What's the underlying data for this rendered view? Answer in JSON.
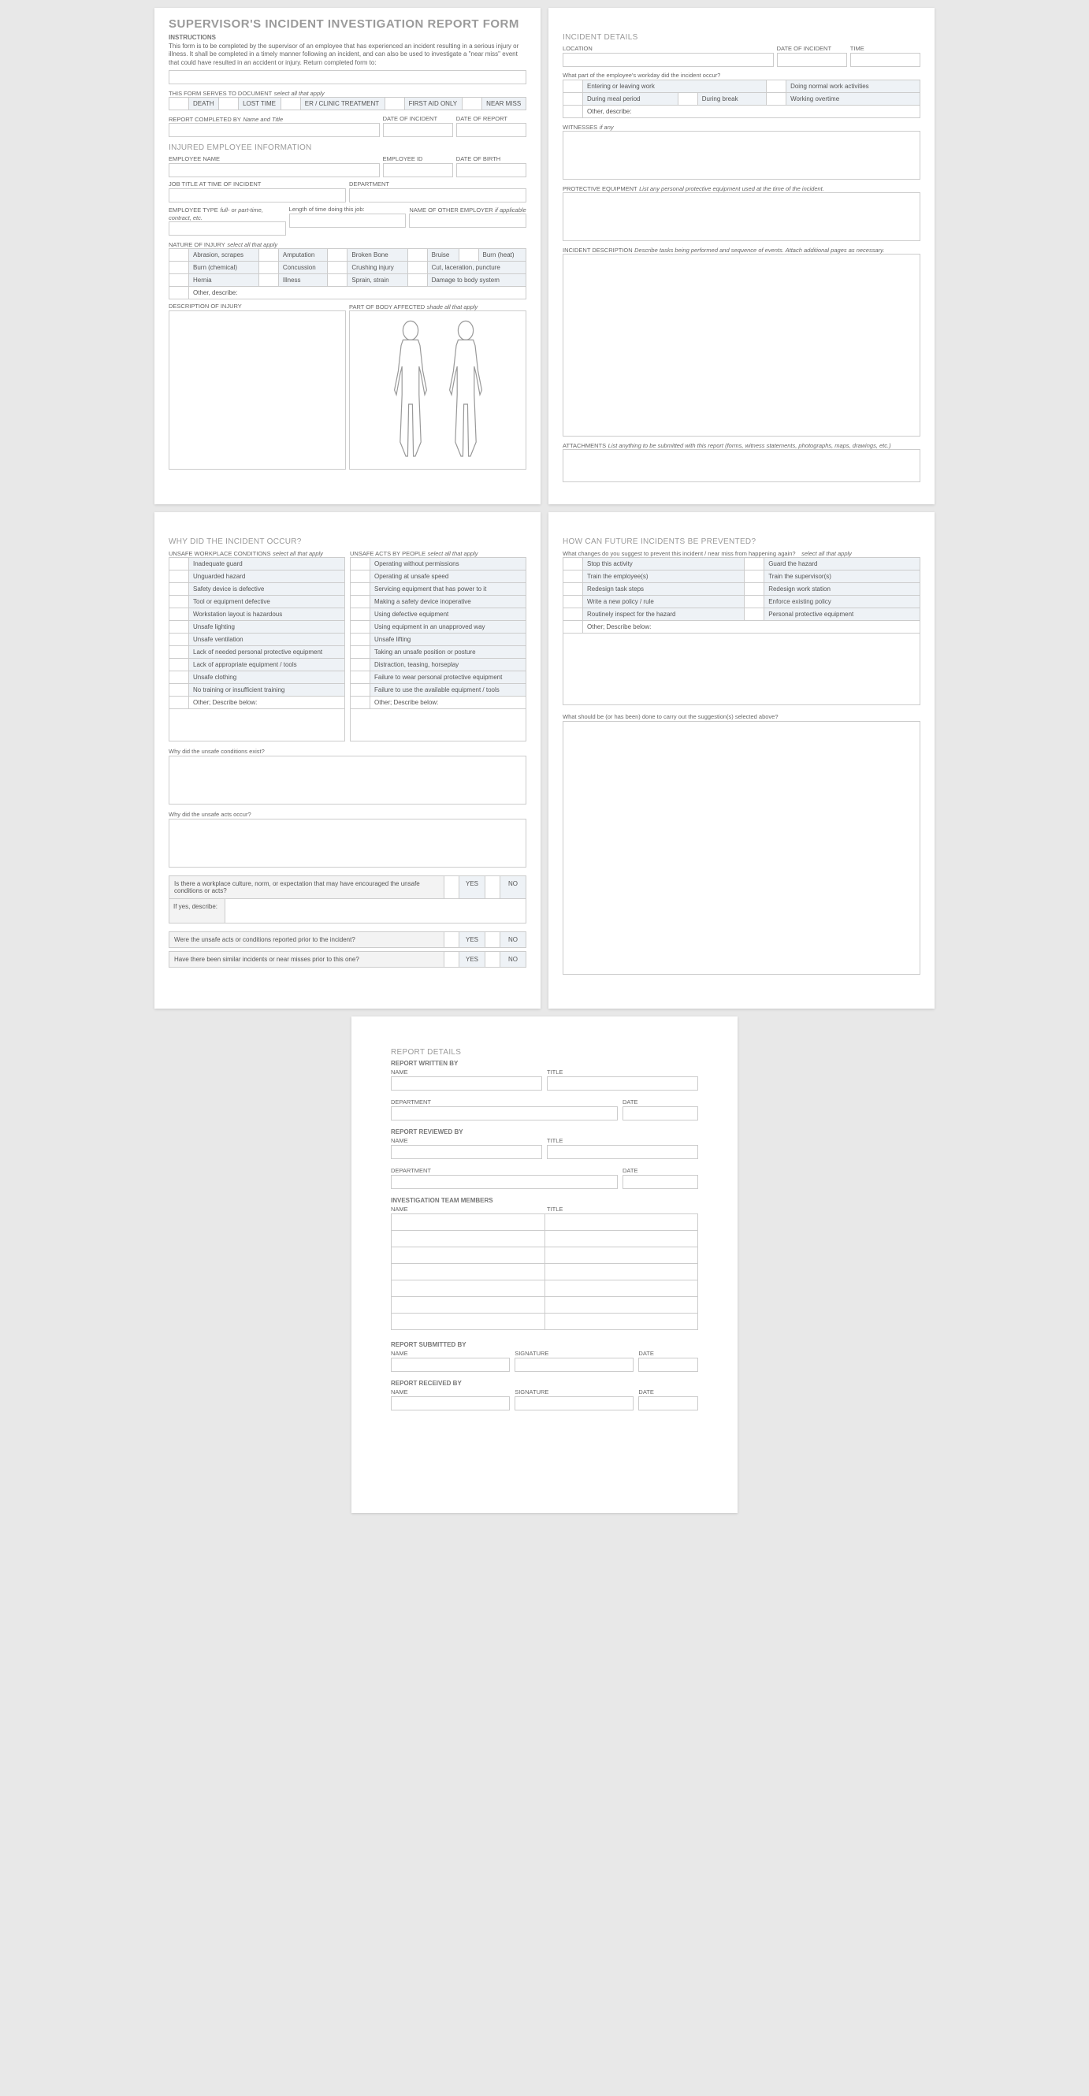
{
  "page1": {
    "title": "SUPERVISOR'S INCIDENT INVESTIGATION REPORT FORM",
    "instructions_label": "INSTRUCTIONS",
    "instructions_text": "This form is to be completed by the supervisor of an employee that has experienced an incident resulting in a serious injury or illness. It shall be completed in a timely manner following an incident, and can also be used to investigate a \"near miss\" event that could have resulted in an accident or injury. Return completed form to:",
    "doc_label": "THIS FORM SERVES TO DOCUMENT",
    "doc_hint": "select all that apply",
    "doc_opts": [
      "DEATH",
      "LOST TIME",
      "ER / CLINIC TREATMENT",
      "FIRST AID ONLY",
      "NEAR MISS"
    ],
    "completed_by": "REPORT COMPLETED BY",
    "completed_hint": "Name and Title",
    "date_incident": "DATE OF INCIDENT",
    "date_report": "DATE OF REPORT",
    "injured_section": "INJURED EMPLOYEE INFORMATION",
    "emp_name": "EMPLOYEE NAME",
    "emp_id": "EMPLOYEE ID",
    "dob": "DATE OF BIRTH",
    "job_title": "JOB TITLE AT TIME OF INCIDENT",
    "department": "DEPARTMENT",
    "emp_type": "EMPLOYEE TYPE",
    "emp_type_hint": "full- or part-time, contract, etc.",
    "length": "Length of time doing this job:",
    "other_employer": "NAME OF OTHER EMPLOYER",
    "other_employer_hint": "if applicable",
    "nature_label": "NATURE OF INJURY",
    "nature_hint": "select all that apply",
    "injuries": [
      "Abrasion, scrapes",
      "Amputation",
      "Broken Bone",
      "Bruise",
      "Burn (heat)",
      "Burn (chemical)",
      "Concussion",
      "Crushing injury",
      "Cut, laceration, puncture",
      "Hernia",
      "Illness",
      "Sprain, strain",
      "Damage to body system",
      "Other, describe:"
    ],
    "desc_injury": "DESCRIPTION OF INJURY",
    "body_part": "PART OF BODY AFFECTED",
    "shade_hint": "shade all that apply"
  },
  "page2": {
    "section": "INCIDENT DETAILS",
    "location": "LOCATION",
    "date_incident": "DATE OF INCIDENT",
    "time": "TIME",
    "workday_q": "What part of the employee's workday did the incident occur?",
    "workday_opts": [
      "Entering or leaving work",
      "Doing normal work activities",
      "During meal period",
      "During break",
      "Working overtime",
      "Other, describe:"
    ],
    "witnesses": "WITNESSES",
    "witnesses_hint": "if any",
    "ppe": "PROTECTIVE EQUIPMENT",
    "ppe_hint": "List any personal protective equipment used at the time of the incident.",
    "incident_desc": "INCIDENT DESCRIPTION",
    "incident_desc_hint": "Describe tasks being performed and sequence of events.  Attach additional pages as necessary.",
    "attachments": "ATTACHMENTS",
    "attachments_hint": "List anything to be submitted with this report (forms, witness statements, photographs, maps, drawings, etc.)"
  },
  "page3": {
    "section": "WHY DID THE INCIDENT OCCUR?",
    "conditions_label": "UNSAFE WORKPLACE CONDITIONS",
    "hint": "select all that apply",
    "conditions": [
      "Inadequate guard",
      "Unguarded hazard",
      "Safety device is defective",
      "Tool or equipment defective",
      "Workstation layout is hazardous",
      "Unsafe lighting",
      "Unsafe ventilation",
      "Lack of needed personal protective equipment",
      "Lack of appropriate equipment / tools",
      "Unsafe clothing",
      "No training or insufficient training",
      "Other; Describe below:"
    ],
    "acts_label": "UNSAFE ACTS BY PEOPLE",
    "acts": [
      "Operating without permissions",
      "Operating at unsafe speed",
      "Servicing equipment that has power to it",
      "Making a safety device inoperative",
      "Using defective equipment",
      "Using equipment in an unapproved way",
      "Unsafe lifting",
      "Taking an unsafe position or posture",
      "Distraction, teasing, horseplay",
      "Failure to wear personal protective equipment",
      "Failure to use the available equipment / tools",
      "Other; Describe below:"
    ],
    "q1": "Why did the unsafe conditions exist?",
    "q2": "Why did the unsafe acts occur?",
    "q3": "Is there a workplace culture, norm, or expectation that may have encouraged the unsafe conditions or acts?",
    "if_yes": "If yes, describe:",
    "q4": "Were the unsafe acts or conditions reported prior to the incident?",
    "q5": "Have there been similar incidents or near misses prior to this one?",
    "yes": "YES",
    "no": "NO"
  },
  "page4": {
    "section": "HOW CAN FUTURE INCIDENTS BE PREVENTED?",
    "changes_q": "What changes do you suggest to prevent this incident / near miss from happening again?",
    "hint": "select all that apply",
    "prevent": [
      "Stop this activity",
      "Guard the hazard",
      "Train the employee(s)",
      "Train the supervisor(s)",
      "Redesign task steps",
      "Redesign work station",
      "Write a new policy / rule",
      "Enforce existing policy",
      "Routinely inspect for the hazard",
      "Personal protective equipment",
      "Other; Describe below:"
    ],
    "carryout_q": "What should be (or has been) done to carry out the suggestion(s) selected above?"
  },
  "page5": {
    "section": "REPORT DETAILS",
    "written_by": "REPORT WRITTEN BY",
    "reviewed_by": "REPORT REVIEWED BY",
    "name": "NAME",
    "title": "TITLE",
    "department": "DEPARTMENT",
    "date": "DATE",
    "signature": "SIGNATURE",
    "team": "INVESTIGATION TEAM MEMBERS",
    "submitted_by": "REPORT SUBMITTED BY",
    "received_by": "REPORT RECEIVED BY"
  }
}
